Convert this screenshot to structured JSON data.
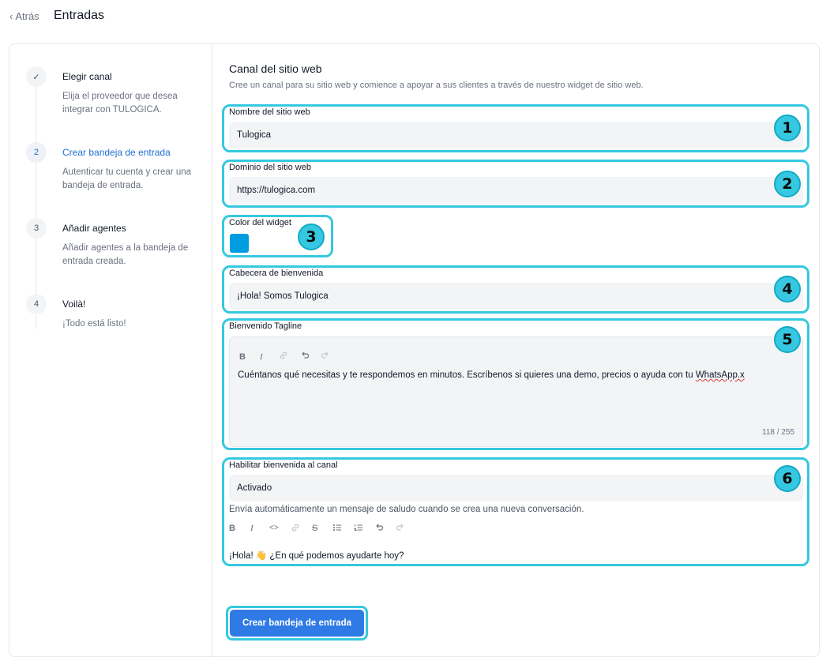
{
  "header": {
    "back_label": "Atrás",
    "title": "Entradas"
  },
  "steps": [
    {
      "number": "✓",
      "title": "Elegir canal",
      "description": "Elija el proveedor que desea integrar con TULOGICA."
    },
    {
      "number": "2",
      "title": "Crear bandeja de entrada",
      "description": "Autenticar tu cuenta y crear una bandeja de entrada."
    },
    {
      "number": "3",
      "title": "Añadir agentes",
      "description": "Añadir agentes a la bandeja de entrada creada."
    },
    {
      "number": "4",
      "title": "Voilà!",
      "description": "¡Todo está listo!"
    }
  ],
  "form": {
    "title": "Canal del sitio web",
    "description": "Cree un canal para su sitio web y comience a apoyar a sus clientes a través de nuestro widget de sitio web.",
    "site_name": {
      "label": "Nombre del sitio web",
      "value": "Tulogica"
    },
    "domain": {
      "label": "Dominio del sitio web",
      "value": "https://tulogica.com"
    },
    "widget_color": {
      "label": "Color del widget",
      "color": "#009ce0"
    },
    "welcome_header": {
      "label": "Cabecera de bienvenida",
      "value": "¡Hola! Somos Tulogica"
    },
    "tagline": {
      "label": "Bienvenido Tagline",
      "text_main": "Cuéntanos qué necesitas y te respondemos en minutos. Escríbenos si quieres una demo, precios o ayuda con tu ",
      "text_flagged": "WhatsApp.x",
      "counter": "118 / 255"
    },
    "greeting": {
      "label": "Habilitar bienvenida al canal",
      "value": "Activado",
      "hint": "Envía automáticamente un mensaje de saludo cuando se crea una nueva conversación.",
      "message": "¡Hola! 👋 ¿En qué podemos ayudarte hoy?"
    },
    "submit_label": "Crear bandeja de entrada"
  },
  "annotations": [
    "1",
    "2",
    "3",
    "4",
    "5",
    "6"
  ],
  "colors": {
    "accent": "#36c8e0",
    "primary_button": "#2f7ae5",
    "active_step": "#1f6fd1"
  }
}
